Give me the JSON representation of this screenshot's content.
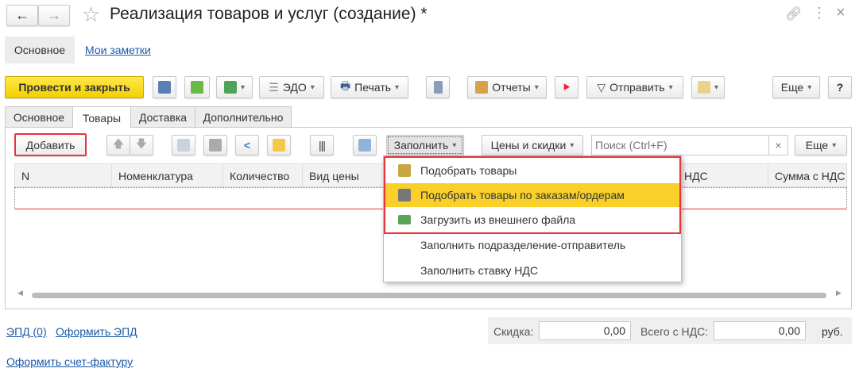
{
  "window": {
    "title": "Реализация товаров и услуг (создание) *"
  },
  "nav": {
    "main": "Основное",
    "notes": "Мои заметки"
  },
  "toolbar": {
    "post_close": "Провести и закрыть",
    "edo": "ЭДО",
    "print": "Печать",
    "reports": "Отчеты",
    "send": "Отправить",
    "more": "Еще",
    "help": "?"
  },
  "tabs": [
    "Основное",
    "Товары",
    "Доставка",
    "Дополнительно"
  ],
  "table_toolbar": {
    "add": "Добавить",
    "fill": "Заполнить",
    "prices": "Цены и скидки",
    "search_placeholder": "Поиск (Ctrl+F)",
    "clear": "×",
    "more": "Еще"
  },
  "columns": [
    "N",
    "Номенклатура",
    "Количество",
    "Вид цены",
    "НДС",
    "Сумма с НДС"
  ],
  "fill_menu": [
    "Подобрать товары",
    "Подобрать товары по заказам/ордерам",
    "Загрузить из внешнего файла",
    "Заполнить подразделение-отправитель",
    "Заполнить ставку НДС"
  ],
  "footer": {
    "epd": "ЭПД (0)",
    "make_epd": "Оформить ЭПД",
    "discount_label": "Скидка:",
    "discount": "0,00",
    "total_label": "Всего с НДС:",
    "total": "0,00",
    "currency": "руб.",
    "invoice": "Оформить счет-фактуру"
  },
  "colors": {
    "primary": "#f5d50a",
    "highlight": "#f9cf2a",
    "annotation": "#e8343a"
  }
}
